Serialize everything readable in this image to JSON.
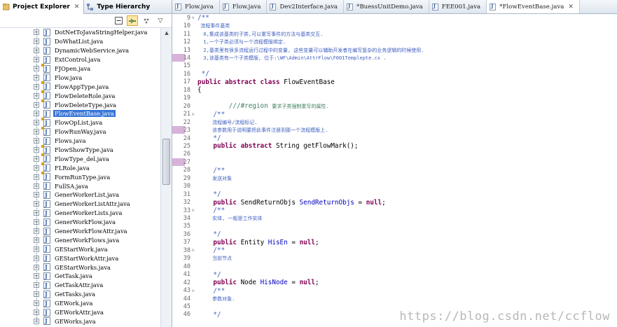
{
  "left_panel": {
    "tabs": [
      {
        "label": "Project Explorer",
        "active": true
      },
      {
        "label": "Type Hierarchy",
        "active": false
      }
    ],
    "tree": [
      {
        "name": "DotNetToJavaStringHelper.java",
        "dirty": false
      },
      {
        "name": "DoWhatList.java",
        "dirty": false
      },
      {
        "name": "DynamicWebService.java",
        "dirty": false
      },
      {
        "name": "ExtControl.java",
        "dirty": false
      },
      {
        "name": "FJOpen.java",
        "dirty": true
      },
      {
        "name": "Flow.java",
        "dirty": false
      },
      {
        "name": "FlowAppType.java",
        "dirty": true
      },
      {
        "name": "FlowDeleteRole.java",
        "dirty": true
      },
      {
        "name": "FlowDeleteType.java",
        "dirty": true
      },
      {
        "name": "FlowEventBase.java",
        "dirty": false,
        "selected": true
      },
      {
        "name": "FlowOpList.java",
        "dirty": true
      },
      {
        "name": "FlowRunWay.java",
        "dirty": true
      },
      {
        "name": "Flows.java",
        "dirty": false
      },
      {
        "name": "FlowShowType.java",
        "dirty": true
      },
      {
        "name": "FlowType_del.java",
        "dirty": true
      },
      {
        "name": "FLRole.java",
        "dirty": true
      },
      {
        "name": "FormRunType.java",
        "dirty": true
      },
      {
        "name": "FullSA.java",
        "dirty": false
      },
      {
        "name": "GenerWorkerList.java",
        "dirty": false
      },
      {
        "name": "GenerWorkerListAttr.java",
        "dirty": false
      },
      {
        "name": "GenerWorkerLists.java",
        "dirty": false
      },
      {
        "name": "GenerWorkFlow.java",
        "dirty": false
      },
      {
        "name": "GenerWorkFlowAttr.java",
        "dirty": false
      },
      {
        "name": "GenerWorkFlows.java",
        "dirty": false
      },
      {
        "name": "GEStartWork.java",
        "dirty": false
      },
      {
        "name": "GEStartWorkAttr.java",
        "dirty": false
      },
      {
        "name": "GEStartWorks.java",
        "dirty": false
      },
      {
        "name": "GetTask.java",
        "dirty": false
      },
      {
        "name": "GetTaskAttr.java",
        "dirty": false
      },
      {
        "name": "GetTasks.java",
        "dirty": false
      },
      {
        "name": "GEWork.java",
        "dirty": false
      },
      {
        "name": "GEWorkAttr.java",
        "dirty": false
      },
      {
        "name": "GEWorks.java",
        "dirty": false
      }
    ]
  },
  "editor": {
    "tabs": [
      {
        "label": "Flow.java",
        "active": false
      },
      {
        "label": "Flow.java",
        "active": false
      },
      {
        "label": "Dev2Interface.java",
        "active": false
      },
      {
        "label": "*BuessUnitDemo.java",
        "active": false
      },
      {
        "label": "FEE001.java",
        "active": false
      },
      {
        "label": "*FlowEventBase.java",
        "active": true
      }
    ],
    "lines": [
      {
        "n": "9",
        "fold": "⊖",
        "cls": "jd",
        "small": false,
        "parts": [
          {
            "t": "/**",
            "c": "jd"
          }
        ]
      },
      {
        "n": "10",
        "fold": "",
        "small": true,
        "parts": [
          {
            "t": " 流程事件基类",
            "c": "jd"
          }
        ]
      },
      {
        "n": "11",
        "fold": "",
        "small": true,
        "parts": [
          {
            "t": "  0,集成该基类的子类,可以重写事件的方法与基类交互.",
            "c": "jd"
          }
        ]
      },
      {
        "n": "12",
        "fold": "",
        "small": true,
        "parts": [
          {
            "t": "  1,一个子类必须与一个流程模版绑定.",
            "c": "jd"
          }
        ]
      },
      {
        "n": "13",
        "fold": "",
        "small": true,
        "parts": [
          {
            "t": "  2,基类里有很多流程运行过程中的变量, 这些变量可以辅助开发者在编写复杂的业务逻辑的时候使用.",
            "c": "jd"
          }
        ]
      },
      {
        "n": "14",
        "fold": "",
        "small": true,
        "marker": true,
        "parts": [
          {
            "t": "  3,该基类有一个子类模版, 位于:\\WF\\Admin\\AttrFlow\\F001Templepte.cs .",
            "c": "jd"
          }
        ]
      },
      {
        "n": "15",
        "fold": "",
        "small": false,
        "parts": [
          {
            "t": "",
            "c": ""
          }
        ]
      },
      {
        "n": "16",
        "fold": "",
        "small": false,
        "parts": [
          {
            "t": " */",
            "c": "jd"
          }
        ]
      },
      {
        "n": "17",
        "fold": "",
        "small": false,
        "parts": [
          {
            "t": "public abstract class",
            "c": "kw"
          },
          {
            "t": " FlowEventBase",
            "c": ""
          }
        ]
      },
      {
        "n": "18",
        "fold": "",
        "small": false,
        "parts": [
          {
            "t": "{",
            "c": ""
          }
        ]
      },
      {
        "n": "19",
        "fold": "",
        "small": false,
        "parts": [
          {
            "t": "",
            "c": ""
          }
        ]
      },
      {
        "n": "20",
        "fold": "",
        "small": false,
        "parts": [
          {
            "t": "        ///#region ",
            "c": "cm"
          },
          {
            "t": "要求子类强制重写的属性.",
            "c": "cm",
            "small": true
          }
        ]
      },
      {
        "n": "21",
        "fold": "⊖",
        "small": false,
        "parts": [
          {
            "t": "    /**",
            "c": "jd"
          }
        ]
      },
      {
        "n": "22",
        "fold": "",
        "small": true,
        "parts": [
          {
            "t": "     流程编号/流程标记.",
            "c": "jd"
          }
        ]
      },
      {
        "n": "23",
        "fold": "",
        "small": true,
        "marker": true,
        "parts": [
          {
            "t": "     该参数用于说明要把此事件注册到那一个流程模版上.",
            "c": "jd"
          }
        ]
      },
      {
        "n": "24",
        "fold": "",
        "small": false,
        "parts": [
          {
            "t": "    */",
            "c": "jd"
          }
        ]
      },
      {
        "n": "25",
        "fold": "",
        "small": false,
        "parts": [
          {
            "t": "    public abstract",
            "c": "kw"
          },
          {
            "t": " String getFlowMark();",
            "c": ""
          }
        ]
      },
      {
        "n": "26",
        "fold": "",
        "small": false,
        "parts": [
          {
            "t": "",
            "c": ""
          }
        ]
      },
      {
        "n": "27",
        "fold": "",
        "small": false,
        "marker": true,
        "parts": [
          {
            "t": "",
            "c": ""
          }
        ]
      },
      {
        "n": "28",
        "fold": "",
        "small": false,
        "parts": [
          {
            "t": "    /**",
            "c": "jd"
          }
        ]
      },
      {
        "n": "29",
        "fold": "",
        "small": true,
        "parts": [
          {
            "t": "     发送对象",
            "c": "jd"
          }
        ]
      },
      {
        "n": "30",
        "fold": "",
        "small": false,
        "parts": [
          {
            "t": "",
            "c": ""
          }
        ]
      },
      {
        "n": "31",
        "fold": "",
        "small": false,
        "parts": [
          {
            "t": "    */",
            "c": "jd"
          }
        ]
      },
      {
        "n": "32",
        "fold": "",
        "small": false,
        "parts": [
          {
            "t": "    public",
            "c": "kw"
          },
          {
            "t": " SendReturnObjs ",
            "c": ""
          },
          {
            "t": "SendReturnObjs",
            "c": "fld"
          },
          {
            "t": " = ",
            "c": ""
          },
          {
            "t": "null",
            "c": "kw"
          },
          {
            "t": ";",
            "c": ""
          }
        ]
      },
      {
        "n": "33",
        "fold": "⊖",
        "small": false,
        "parts": [
          {
            "t": "    /**",
            "c": "jd"
          }
        ]
      },
      {
        "n": "34",
        "fold": "",
        "small": true,
        "parts": [
          {
            "t": "     实体, 一般是工作实体",
            "c": "jd"
          }
        ]
      },
      {
        "n": "35",
        "fold": "",
        "small": false,
        "parts": [
          {
            "t": "",
            "c": ""
          }
        ]
      },
      {
        "n": "36",
        "fold": "",
        "small": false,
        "parts": [
          {
            "t": "    */",
            "c": "jd"
          }
        ]
      },
      {
        "n": "37",
        "fold": "",
        "small": false,
        "parts": [
          {
            "t": "    public",
            "c": "kw"
          },
          {
            "t": " Entity ",
            "c": ""
          },
          {
            "t": "HisEn",
            "c": "fld"
          },
          {
            "t": " = ",
            "c": ""
          },
          {
            "t": "null",
            "c": "kw"
          },
          {
            "t": ";",
            "c": ""
          }
        ]
      },
      {
        "n": "38",
        "fold": "⊖",
        "small": false,
        "parts": [
          {
            "t": "    /**",
            "c": "jd"
          }
        ]
      },
      {
        "n": "39",
        "fold": "",
        "small": true,
        "parts": [
          {
            "t": "     当前节点",
            "c": "jd"
          }
        ]
      },
      {
        "n": "40",
        "fold": "",
        "small": false,
        "parts": [
          {
            "t": "",
            "c": ""
          }
        ]
      },
      {
        "n": "41",
        "fold": "",
        "small": false,
        "parts": [
          {
            "t": "    */",
            "c": "jd"
          }
        ]
      },
      {
        "n": "42",
        "fold": "",
        "small": false,
        "parts": [
          {
            "t": "    public",
            "c": "kw"
          },
          {
            "t": " Node ",
            "c": ""
          },
          {
            "t": "HisNode",
            "c": "fld"
          },
          {
            "t": " = ",
            "c": ""
          },
          {
            "t": "null",
            "c": "kw"
          },
          {
            "t": ";",
            "c": ""
          }
        ]
      },
      {
        "n": "43",
        "fold": "⊖",
        "small": false,
        "parts": [
          {
            "t": "    /**",
            "c": "jd"
          }
        ]
      },
      {
        "n": "44",
        "fold": "",
        "small": true,
        "parts": [
          {
            "t": "     参数对象.",
            "c": "jd"
          }
        ]
      },
      {
        "n": "45",
        "fold": "",
        "small": false,
        "parts": [
          {
            "t": "",
            "c": ""
          }
        ]
      },
      {
        "n": "46",
        "fold": "",
        "small": false,
        "parts": [
          {
            "t": "    */",
            "c": "jd"
          }
        ]
      }
    ]
  },
  "watermark": "https://blog.csdn.net/ccflow",
  "colors": {
    "selection": "#3875d7",
    "keyword": "#7f0055",
    "javadoc": "#3f5fbf",
    "comment": "#3f7f5f",
    "field": "#0000c0",
    "marker": "#d7b3d9"
  }
}
